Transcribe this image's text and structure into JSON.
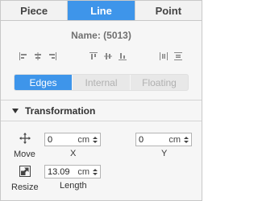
{
  "tabs": [
    {
      "label": "Piece",
      "active": false
    },
    {
      "label": "Line",
      "active": true
    },
    {
      "label": "Point",
      "active": false
    }
  ],
  "name_label": "Name: (5013)",
  "align_icons": [
    "align-left-icon",
    "align-center-horizontal-icon",
    "align-right-icon",
    "align-top-icon",
    "align-center-vertical-icon",
    "align-bottom-icon",
    "distribute-horizontal-icon",
    "distribute-vertical-icon"
  ],
  "segments": [
    {
      "label": "Edges",
      "active": true
    },
    {
      "label": "Internal",
      "active": false
    },
    {
      "label": "Floating",
      "active": false
    }
  ],
  "section": {
    "title": "Transformation"
  },
  "move": {
    "label": "Move",
    "x_value": "0",
    "x_unit": "cm",
    "x_label": "X",
    "y_value": "0",
    "y_unit": "cm",
    "y_label": "Y"
  },
  "resize": {
    "label": "Resize",
    "value": "13.09",
    "unit": "cm",
    "sub_label": "Length"
  },
  "colors": {
    "accent": "#3e95ea",
    "panel_bg": "#f6f6f6"
  }
}
